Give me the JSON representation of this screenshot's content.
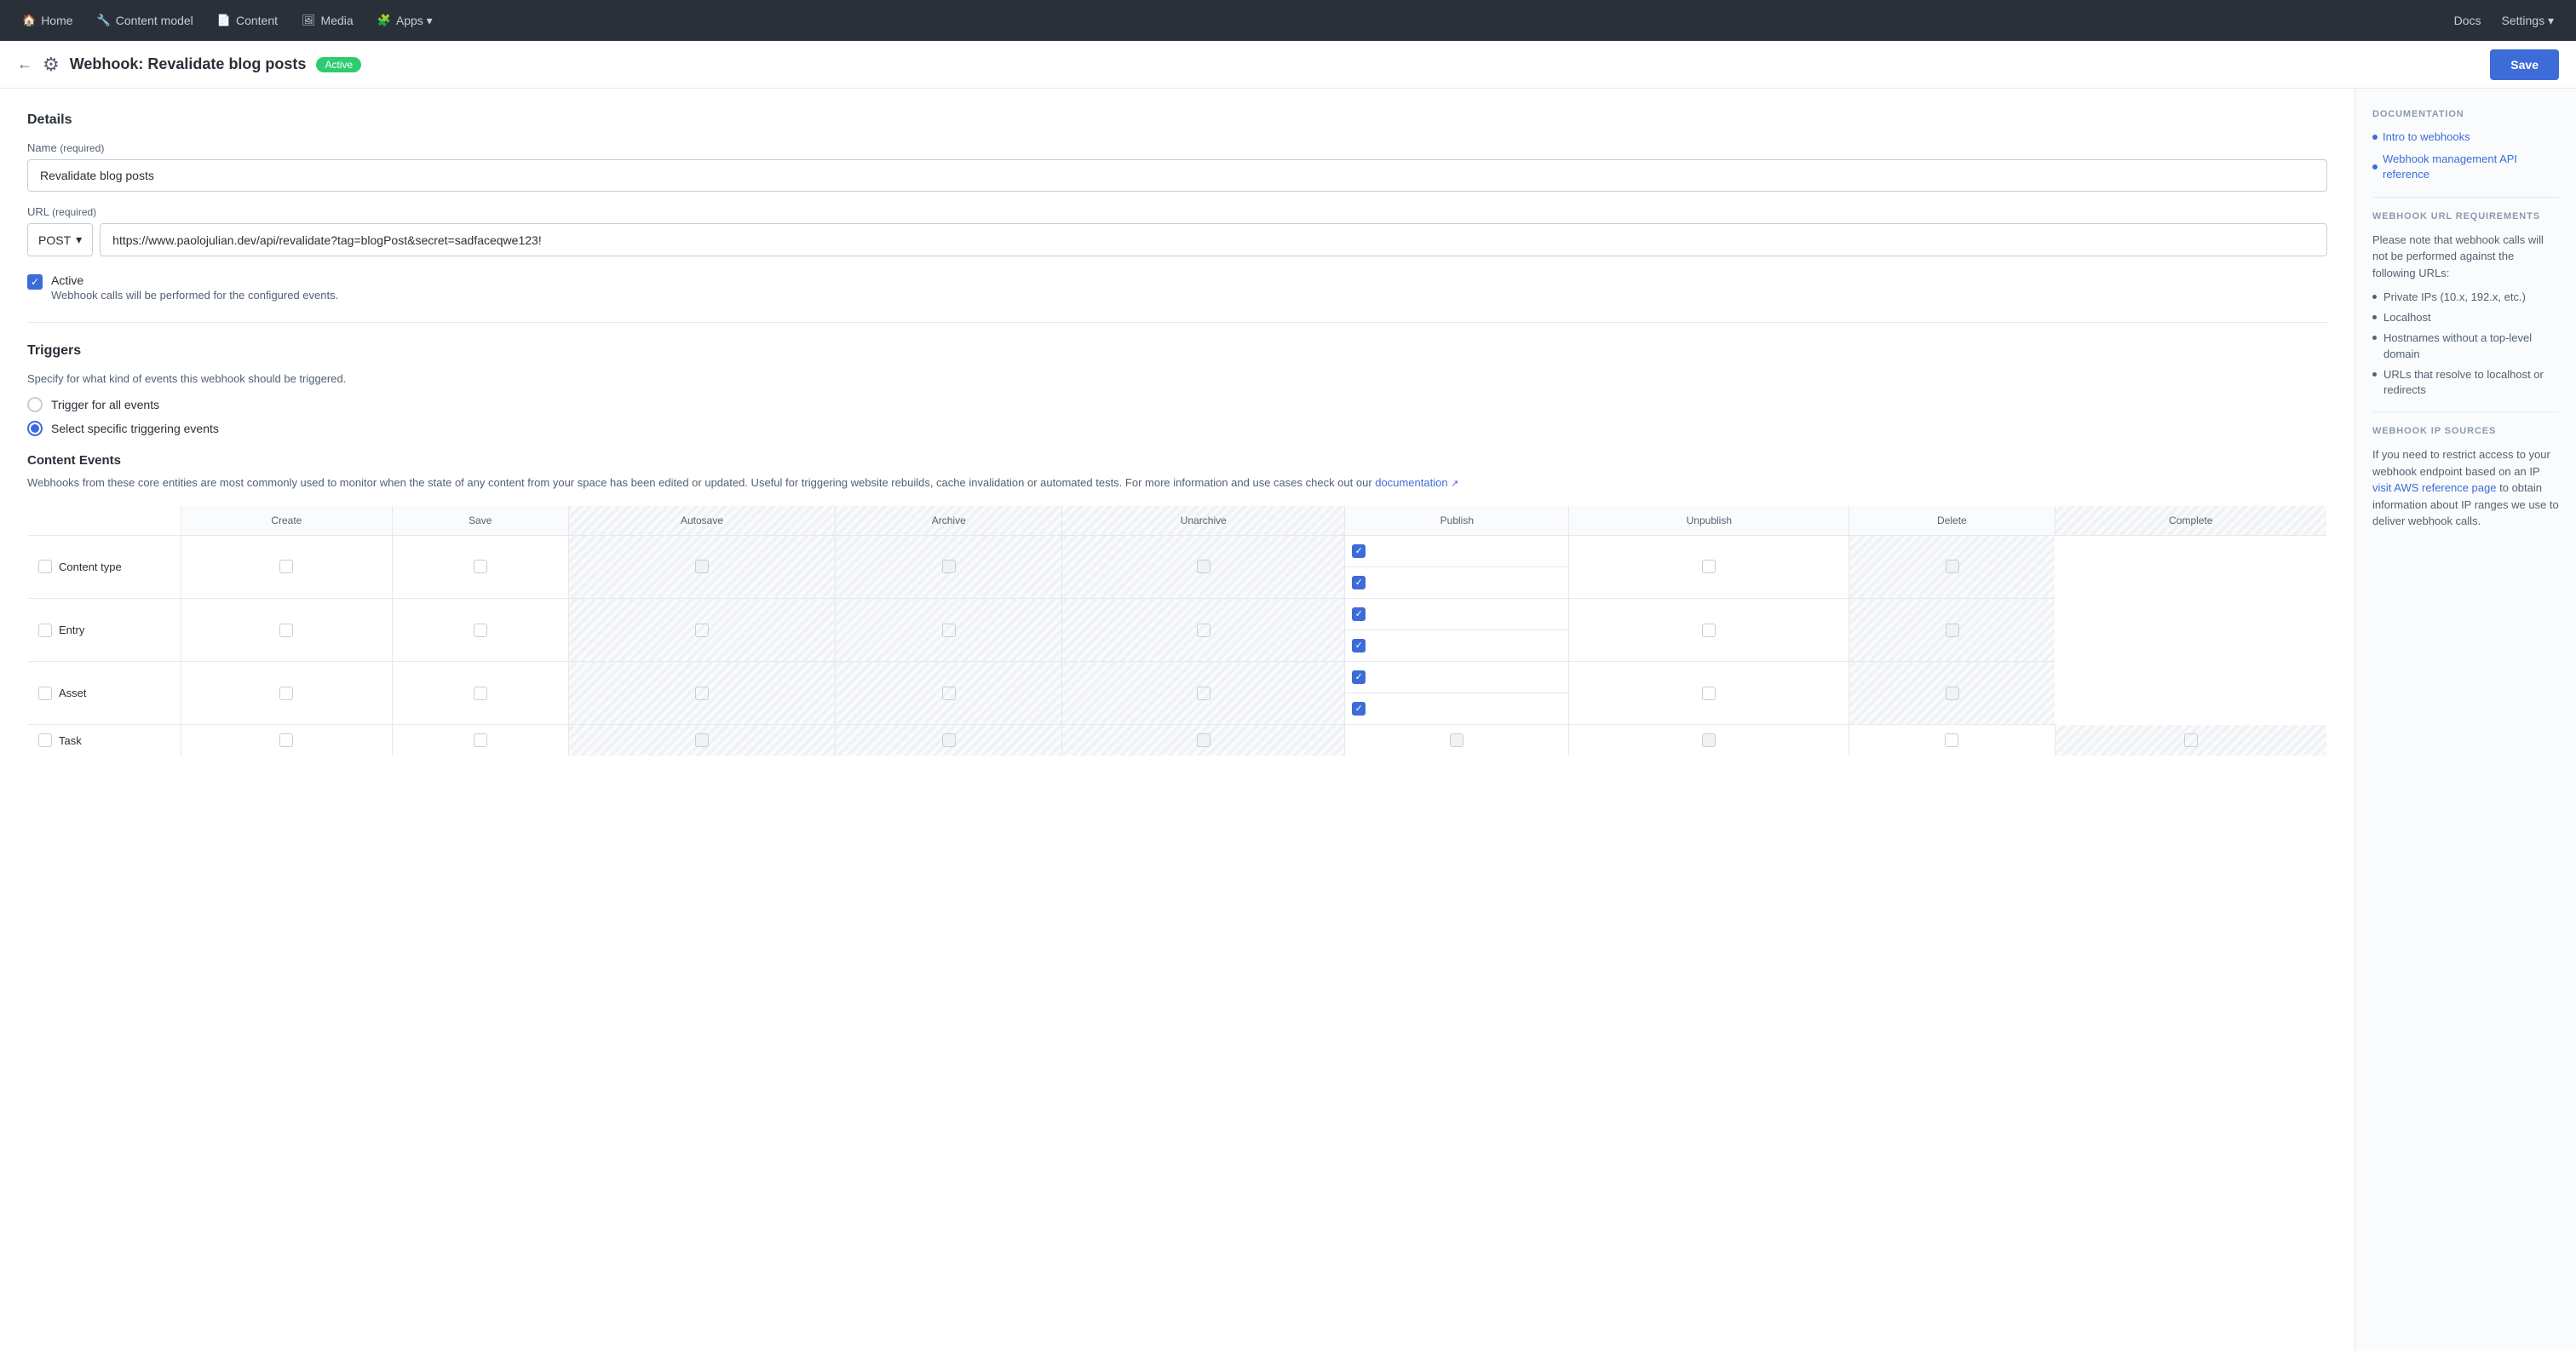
{
  "nav": {
    "items": [
      {
        "label": "Home",
        "icon": "🏠"
      },
      {
        "label": "Content model",
        "icon": "🔧"
      },
      {
        "label": "Content",
        "icon": "📄"
      },
      {
        "label": "Media",
        "icon": "🖼"
      },
      {
        "label": "Apps ▾",
        "icon": "🧩"
      }
    ],
    "right": [
      {
        "label": "Docs"
      },
      {
        "label": "Settings ▾"
      }
    ]
  },
  "header": {
    "back_label": "←",
    "gear_icon": "⚙",
    "title": "Webhook: Revalidate blog posts",
    "status": "Active",
    "save_label": "Save"
  },
  "form": {
    "details_title": "Details",
    "name_label": "Name",
    "name_required": "(required)",
    "name_value": "Revalidate blog posts",
    "url_label": "URL",
    "url_required": "(required)",
    "method": "POST",
    "url_value": "https://www.paolojulian.dev/api/revalidate?tag=blogPost&secret=sadfaceqwe123!",
    "active_checked": true,
    "active_label": "Active",
    "active_desc": "Webhook calls will be performed for the configured events."
  },
  "triggers": {
    "title": "Triggers",
    "desc": "Specify for what kind of events this webhook should be triggered.",
    "option1": "Trigger for all events",
    "option2": "Select specific triggering events",
    "selected": "option2"
  },
  "content_events": {
    "title": "Content Events",
    "desc": "Webhooks from these core entities are most commonly used to monitor when the state of any content from your space has been edited or updated. Useful for triggering website rebuilds, cache invalidation or automated tests. For more information and use cases check out our",
    "doc_link_text": "documentation",
    "columns": [
      "",
      "Create",
      "Save",
      "Autosave",
      "Archive",
      "Unarchive",
      "Publish",
      "Unpublish",
      "Delete",
      "Complete"
    ],
    "rows": [
      {
        "name": "Content type",
        "create": "unchecked",
        "save": "unchecked",
        "autosave": "disabled",
        "archive": "disabled",
        "unarchive": "disabled",
        "publish": "checked",
        "unpublish": "checked",
        "delete": "unchecked",
        "complete": "disabled"
      },
      {
        "name": "Entry",
        "create": "unchecked",
        "save": "unchecked",
        "autosave": "unchecked",
        "archive": "unchecked",
        "unarchive": "unchecked",
        "publish": "checked",
        "unpublish": "checked",
        "delete": "unchecked",
        "complete": "disabled"
      },
      {
        "name": "Asset",
        "create": "unchecked",
        "save": "unchecked",
        "autosave": "unchecked",
        "archive": "unchecked",
        "unarchive": "unchecked",
        "publish": "checked",
        "unpublish": "checked",
        "delete": "unchecked",
        "complete": "disabled"
      },
      {
        "name": "Task",
        "create": "unchecked",
        "save": "unchecked",
        "autosave": "disabled",
        "archive": "disabled",
        "unarchive": "disabled",
        "publish": "disabled",
        "unpublish": "disabled",
        "delete": "unchecked",
        "complete": "unchecked"
      }
    ]
  },
  "sidebar": {
    "doc_title": "DOCUMENTATION",
    "links": [
      {
        "text": "Intro to webhooks",
        "bullet": true
      },
      {
        "text": "Webhook management API reference",
        "bullet": true
      }
    ],
    "url_req_title": "WEBHOOK URL REQUIREMENTS",
    "url_req_text": "Please note that webhook calls will not be performed against the following URLs:",
    "url_req_bullets": [
      "Private IPs (10.x, 192.x, etc.)",
      "Localhost",
      "Hostnames without a top-level domain",
      "URLs that resolve to localhost or redirects"
    ],
    "ip_title": "WEBHOOK IP SOURCES",
    "ip_text": "If you need to restrict access to your webhook endpoint based on an IP",
    "ip_link": "visit AWS reference page",
    "ip_text2": "to obtain information about IP ranges we use to deliver webhook calls."
  }
}
